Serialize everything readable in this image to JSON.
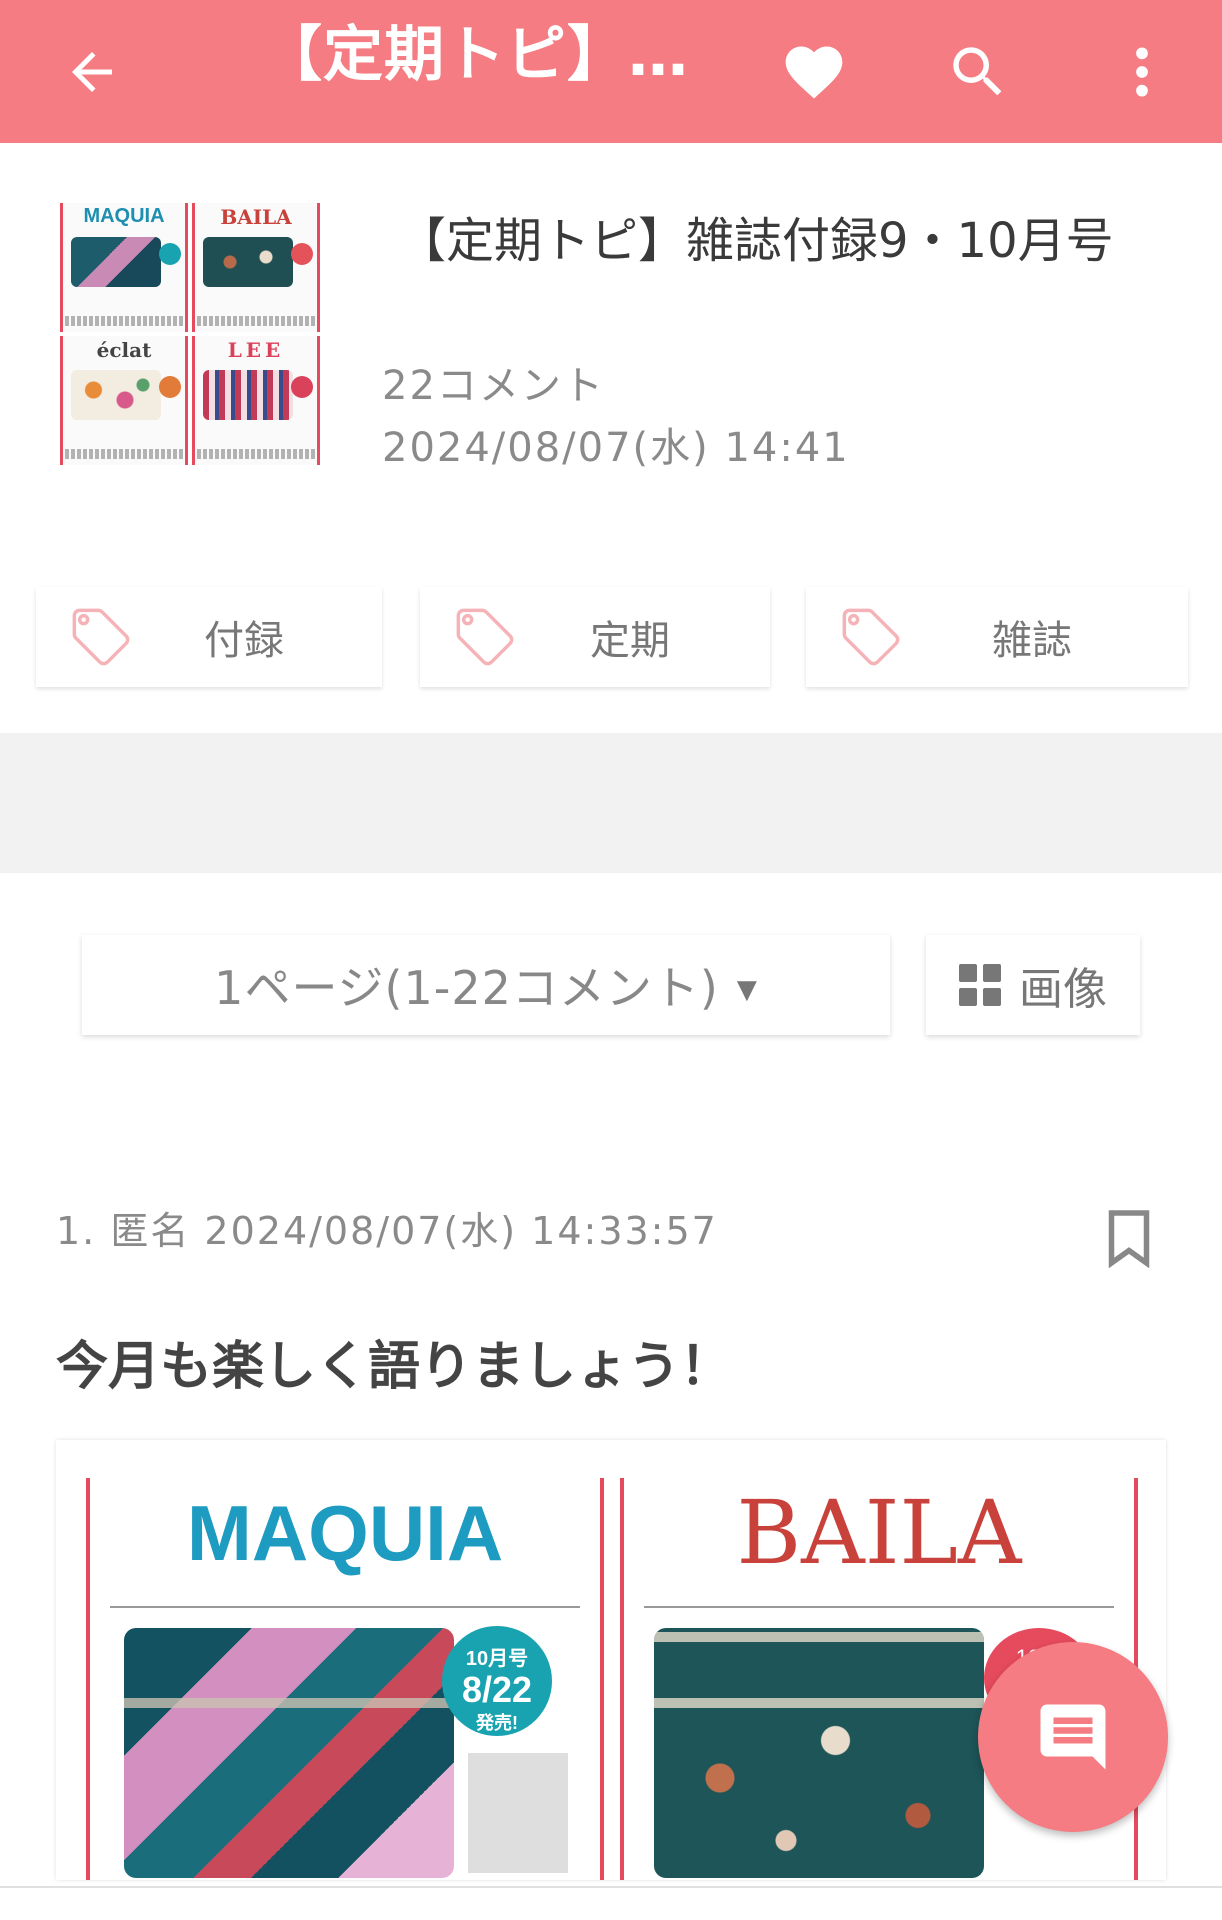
{
  "appbar": {
    "title": "【定期トピ】…",
    "back_icon": "arrow-back-icon",
    "favorite_icon": "heart-icon",
    "search_icon": "search-icon",
    "menu_icon": "more-vert-icon",
    "color": "#f47c82"
  },
  "topic": {
    "thumbnail_magazines": [
      "MAQUIA",
      "BAILA",
      "éclat",
      "LEE"
    ],
    "title": "【定期トピ】雑誌付録9・10月号",
    "comment_count": "22コメント",
    "date": "2024/08/07(水) 14:41"
  },
  "tags": [
    {
      "label": "付録"
    },
    {
      "label": "定期"
    },
    {
      "label": "雑誌"
    }
  ],
  "pager": {
    "label": "1ページ(1-22コメント)",
    "caret": "▼",
    "image_button_label": "画像"
  },
  "comments": [
    {
      "meta": "1.  匿名  2024/08/07(水) 14:33:57",
      "body": "今月も楽しく語りましょう！",
      "image_magazines": [
        "MAQUIA",
        "BAILA"
      ],
      "badge_line1": "10月号",
      "badge_line2": "8/22",
      "badge_line3": "発売!",
      "badge_partial": "10月"
    }
  ],
  "fab": {
    "icon": "comment-icon"
  }
}
